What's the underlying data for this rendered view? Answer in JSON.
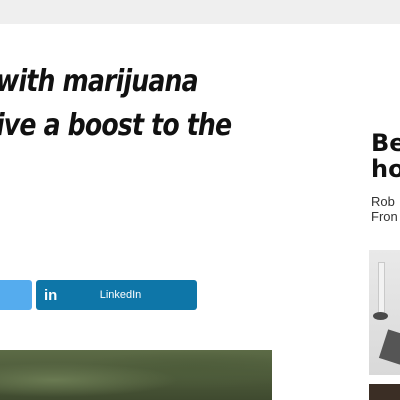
{
  "article": {
    "headline_lines": [
      "with marijuana",
      "ive a boost to the"
    ]
  },
  "share": {
    "twitter_icon": "twitter-icon",
    "linkedin_icon": "linkedin-icon",
    "linkedin_glyph": "in",
    "linkedin_label": "LinkedIn",
    "colors": {
      "twitter": "#55acee",
      "linkedin": "#0e76a8"
    }
  },
  "sidebar": {
    "title_lines": [
      "Be",
      "ho"
    ],
    "meta_lines": [
      "Rob",
      "Fron"
    ]
  }
}
